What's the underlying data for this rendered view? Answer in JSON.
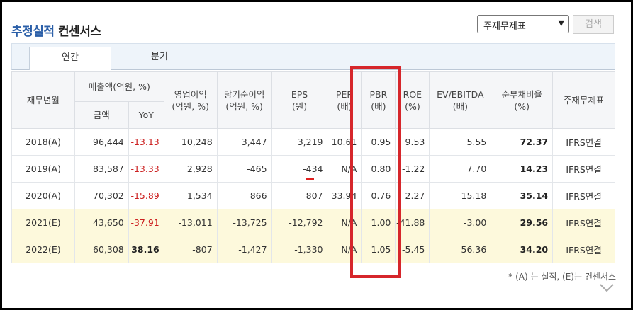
{
  "header": {
    "title_highlight": "추정실적",
    "title_rest": " 컨센서스",
    "select_value": "주재무제표",
    "search_label": "검색"
  },
  "tabs": [
    {
      "label": "연간",
      "active": true
    },
    {
      "label": "분기",
      "active": false
    }
  ],
  "table": {
    "headers": {
      "year": "재무년월",
      "sales": "매출액(억원, %)",
      "sales_amount": "금액",
      "sales_yoy": "YoY",
      "op_profit": [
        "영업이익",
        "(억원, %)"
      ],
      "net_income": [
        "당기순이익",
        "(억원, %)"
      ],
      "eps": [
        "EPS",
        "(원)"
      ],
      "per": [
        "PER",
        "(배)"
      ],
      "pbr": [
        "PBR",
        "(배)"
      ],
      "roe": [
        "ROE",
        "(%)"
      ],
      "ev_ebitda": [
        "EV/EBITDA",
        "(배)"
      ],
      "debt_ratio": [
        "순부채비율",
        "(%)"
      ],
      "stmt": "주재무제표"
    },
    "rows": [
      {
        "year": "2018(A)",
        "sales": "96,444",
        "yoy": "-13.13",
        "op": "10,248",
        "net": "3,447",
        "eps": "3,219",
        "per": "10.61",
        "pbr": "0.95",
        "roe": "9.53",
        "ev": "5.55",
        "debt": "72.37",
        "stmt": "IFRS연결",
        "est": false
      },
      {
        "year": "2019(A)",
        "sales": "83,587",
        "yoy": "-13.33",
        "op": "2,928",
        "net": "-465",
        "eps": "-434",
        "per": "N/A",
        "pbr": "0.80",
        "roe": "-1.22",
        "ev": "7.70",
        "debt": "14.23",
        "stmt": "IFRS연결",
        "est": false
      },
      {
        "year": "2020(A)",
        "sales": "70,302",
        "yoy": "-15.89",
        "op": "1,534",
        "net": "866",
        "eps": "807",
        "per": "33.94",
        "pbr": "0.76",
        "roe": "2.27",
        "ev": "15.18",
        "debt": "35.14",
        "stmt": "IFRS연결",
        "est": false
      },
      {
        "year": "2021(E)",
        "sales": "43,650",
        "yoy": "-37.91",
        "op": "-13,011",
        "net": "-13,725",
        "eps": "-12,792",
        "per": "N/A",
        "pbr": "1.00",
        "roe": "-41.88",
        "ev": "-3.00",
        "debt": "29.56",
        "stmt": "IFRS연결",
        "est": true
      },
      {
        "year": "2022(E)",
        "sales": "60,308",
        "yoy": "38.16",
        "op": "-807",
        "net": "-1,427",
        "eps": "-1,330",
        "per": "N/A",
        "pbr": "1.05",
        "roe": "-5.45",
        "ev": "56.36",
        "debt": "34.20",
        "stmt": "IFRS연결",
        "est": true
      }
    ]
  },
  "footnote": "* (A) 는 실적, (E)는 컨센서스",
  "colors": {
    "accent": "#2b5fa8",
    "negative": "#cc2020",
    "highlight_box": "#d6262b",
    "estimate_bg": "#fdf9dc"
  }
}
